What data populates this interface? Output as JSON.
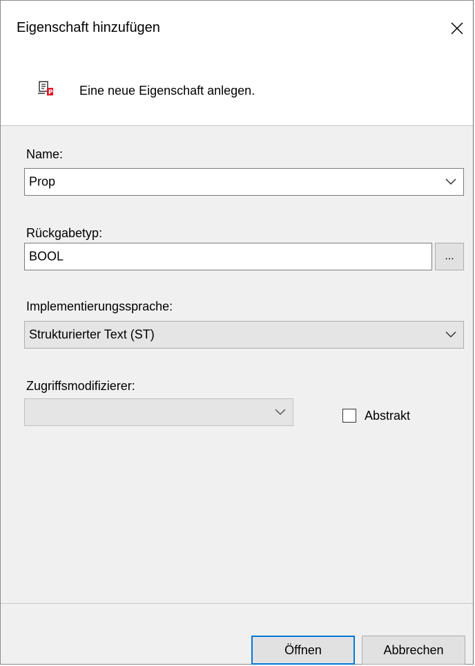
{
  "window": {
    "title": "Eigenschaft hinzufügen",
    "close_icon": "close-icon"
  },
  "header": {
    "icon": "property-icon",
    "description": "Eine neue Eigenschaft anlegen."
  },
  "form": {
    "name_label": "Name:",
    "name_value": "Prop",
    "return_type_label": "Rückgabetyp:",
    "return_type_value": "BOOL",
    "browse_label": "...",
    "language_label": "Implementierungssprache:",
    "language_value": "Strukturierter Text (ST)",
    "access_label": "Zugriffsmodifizierer:",
    "access_value": "",
    "abstract_label": "Abstrakt",
    "abstract_checked": false
  },
  "buttons": {
    "open_label": "Öffnen",
    "cancel_label": "Abbrechen"
  },
  "colors": {
    "accent": "#0078d7",
    "icon_red": "#e81123"
  }
}
